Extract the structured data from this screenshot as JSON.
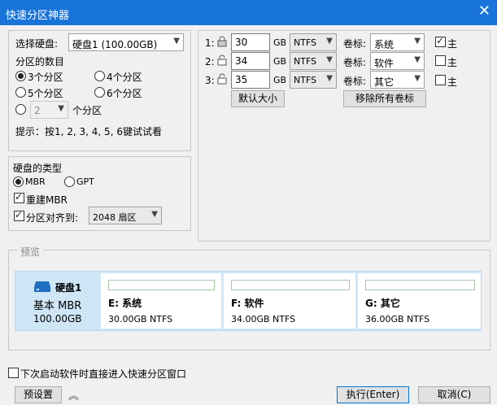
{
  "window": {
    "title": "快速分区神器",
    "close": "✕"
  },
  "disk_group": {
    "select_label": "选择硬盘:",
    "disk_value": "硬盘1 (100.00GB)",
    "count_label": "分区的数目",
    "opt3": "3个分区",
    "opt4": "4个分区",
    "opt5": "5个分区",
    "opt6": "6个分区",
    "custom_value": "2",
    "custom_suffix": "个分区",
    "hint": "提示：按1, 2, 3, 4, 5, 6键试试看",
    "selected": "3"
  },
  "type_group": {
    "title": "硬盘的类型",
    "mbr": "MBR",
    "gpt": "GPT",
    "rebuild_mbr": "重建MBR",
    "align_label": "分区对齐到:",
    "align_value": "2048 扇区"
  },
  "partitions": [
    {
      "index": "1:",
      "size": "30",
      "unit": "GB",
      "fs": "NTFS",
      "vol_label": "卷标:",
      "vol": "系统",
      "primary": "主",
      "primary_checked": true
    },
    {
      "index": "2:",
      "size": "34",
      "unit": "GB",
      "fs": "NTFS",
      "vol_label": "卷标:",
      "vol": "软件",
      "primary": "主",
      "primary_checked": false
    },
    {
      "index": "3:",
      "size": "35",
      "unit": "GB",
      "fs": "NTFS",
      "vol_label": "卷标:",
      "vol": "其它",
      "primary": "主",
      "primary_checked": false
    }
  ],
  "buttons": {
    "default_size": "默认大小",
    "remove_labels": "移除所有卷标",
    "preset": "预设置",
    "execute": "执行(Enter)",
    "cancel": "取消(C)"
  },
  "preview": {
    "title": "预览",
    "disk_name": "硬盘1",
    "disk_type": "基本 MBR",
    "disk_size": "100.00GB",
    "parts": [
      {
        "name": "E: 系统",
        "size": "30.00GB NTFS"
      },
      {
        "name": "F: 软件",
        "size": "34.00GB NTFS"
      },
      {
        "name": "G: 其它",
        "size": "36.00GB NTFS"
      }
    ]
  },
  "footer": {
    "startup_label": "下次启动软件时直接进入快速分区窗口"
  },
  "colors": {
    "titlebar": "#1874d8",
    "preview_bg": "#cfe6f7",
    "disk_icon": "#1e6fc2"
  }
}
